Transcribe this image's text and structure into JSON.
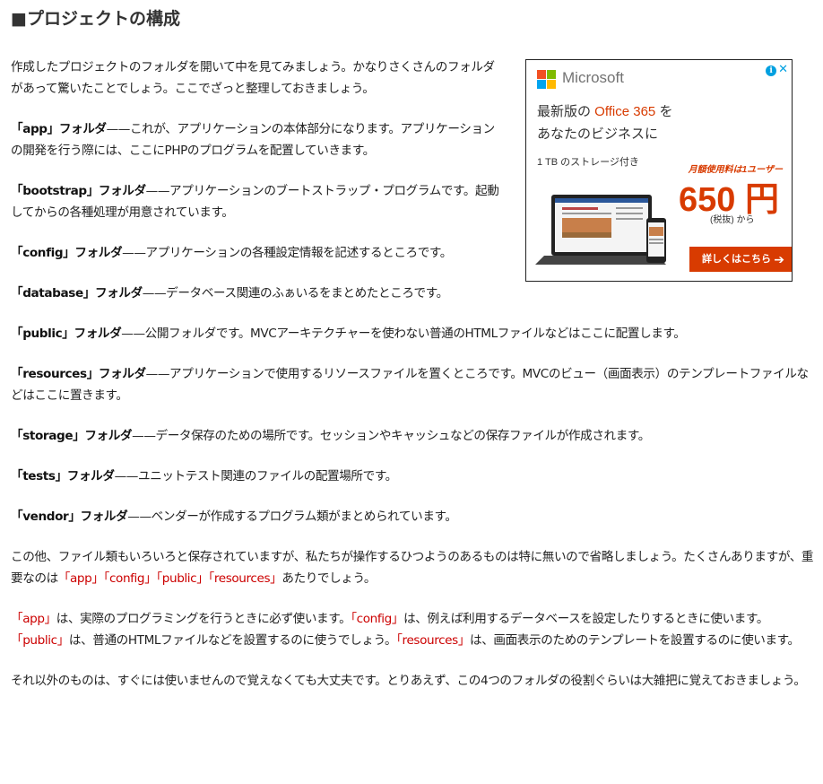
{
  "heading": "■プロジェクトの構成",
  "paragraphs": {
    "intro": "作成したプロジェクトのフォルダを開いて中を見てみましょう。かなりさくさんのフォルダがあって驚いたことでしょう。ここでざっと整理しておきましょう。",
    "app": {
      "name": "「app」フォルダ",
      "desc": "——これが、アプリケーションの本体部分になります。アプリケーションの開発を行う際には、ここにPHPのプログラムを配置していきます。"
    },
    "bootstrap": {
      "name": "「bootstrap」フォルダ",
      "desc": "——アプリケーションのブートストラップ・プログラムです。起動してからの各種処理が用意されています。"
    },
    "config": {
      "name": "「config」フォルダ",
      "desc": "——アプリケーションの各種設定情報を記述するところです。"
    },
    "database": {
      "name": "「database」フォルダ",
      "desc": "——データベース関連のふぁいるをまとめたところです。"
    },
    "public": {
      "name": "「public」フォルダ",
      "desc": "——公開フォルダです。MVCアーキテクチャーを使わない普通のHTMLファイルなどはここに配置します。"
    },
    "resources": {
      "name": "「resources」フォルダ",
      "desc": "——アプリケーションで使用するリソースファイルを置くところです。MVCのビュー（画面表示）のテンプレートファイルなどはここに置きます。"
    },
    "storage": {
      "name": "「storage」フォルダ",
      "desc": "——データ保存のための場所です。セッションやキャッシュなどの保存ファイルが作成されます。"
    },
    "tests": {
      "name": "「tests」フォルダ",
      "desc": "——ユニットテスト関連のファイルの配置場所です。"
    },
    "vendor": {
      "name": "「vendor」フォルダ",
      "desc": "——ベンダーが作成するプログラム類がまとめられています。"
    },
    "summary": {
      "text1": "この他、ファイル類もいろいろと保存されていますが、私たちが操作するひつようのあるものは特に無いので省略しましょう。たくさんありますが、重要なのは",
      "kw_app": "「app」",
      "kw_config": "「config」",
      "kw_public": "「public」",
      "kw_resources": "「resources」",
      "text2": "あたりでしょう。"
    },
    "detail": {
      "kw_app": "「app」",
      "t1": "は、実際のプログラミングを行うときに必ず使います。",
      "kw_config": "「config」",
      "t2": "は、例えば利用するデータベースを設定したりするときに使います。",
      "kw_public": "「public」",
      "t3": "は、普通のHTMLファイルなどを設置するのに使うでしょう。",
      "kw_resources": "「resources」",
      "t4": "は、画面表示のためのテンプレートを設置するのに使います。"
    },
    "closing": "それ以外のものは、すぐには使いませんので覚えなくても大丈夫です。とりあえず、この4つのフォルダの役割ぐらいは大雑把に覚えておきましょう。"
  },
  "ad": {
    "brand": "Microsoft",
    "line1_pre": "最新版の ",
    "line1_accent": "Office 365",
    "line1_post": " を",
    "line2": "あなたのビジネスに",
    "storage": "1 TB のストレージ付き",
    "price_label": "月額使用料は1ユーザー",
    "price": "650 円",
    "price_note": "(税抜) から",
    "cta": "詳しくはこちら",
    "info_icon": "i",
    "close_icon": "✕",
    "accent_color": "#d83b01"
  },
  "colors": {
    "keyword": "#cc0000",
    "text": "#222222"
  }
}
